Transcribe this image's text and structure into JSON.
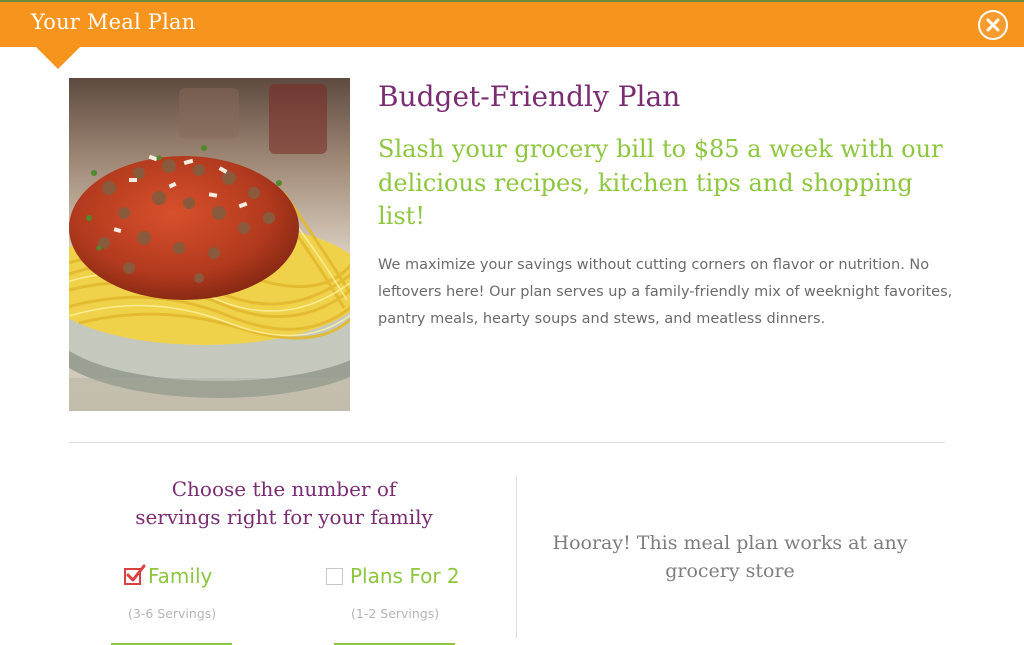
{
  "header": {
    "title": "Your Meal Plan",
    "close_icon": "close-circle-icon",
    "bar_color": "#f7941d"
  },
  "plan": {
    "image": "spaghetti-bolognese-photo",
    "title": "Budget-Friendly Plan",
    "subtitle": "Slash your grocery bill to $85 a week with our delicious recipes, kitchen tips and shopping list!",
    "description": "We maximize your savings without cutting corners on flavor or nutrition. No leftovers here! Our plan serves up a family-friendly mix of weeknight favorites, pantry meals, hearty soups and stews, and meatless dinners."
  },
  "servings": {
    "heading_line1": "Choose the number of",
    "heading_line2": "servings right for your family",
    "options": [
      {
        "label": "Family",
        "sublabel": "(3-6 Servings)",
        "checked": true
      },
      {
        "label": "Plans For 2",
        "sublabel": "(1-2 Servings)",
        "checked": false
      }
    ]
  },
  "store": {
    "line1": "Hooray! This meal plan works at any",
    "line2": "grocery store"
  },
  "colors": {
    "title_purple": "#7a2d72",
    "accent_green": "#8dc63f",
    "check_red": "#d9403f"
  }
}
